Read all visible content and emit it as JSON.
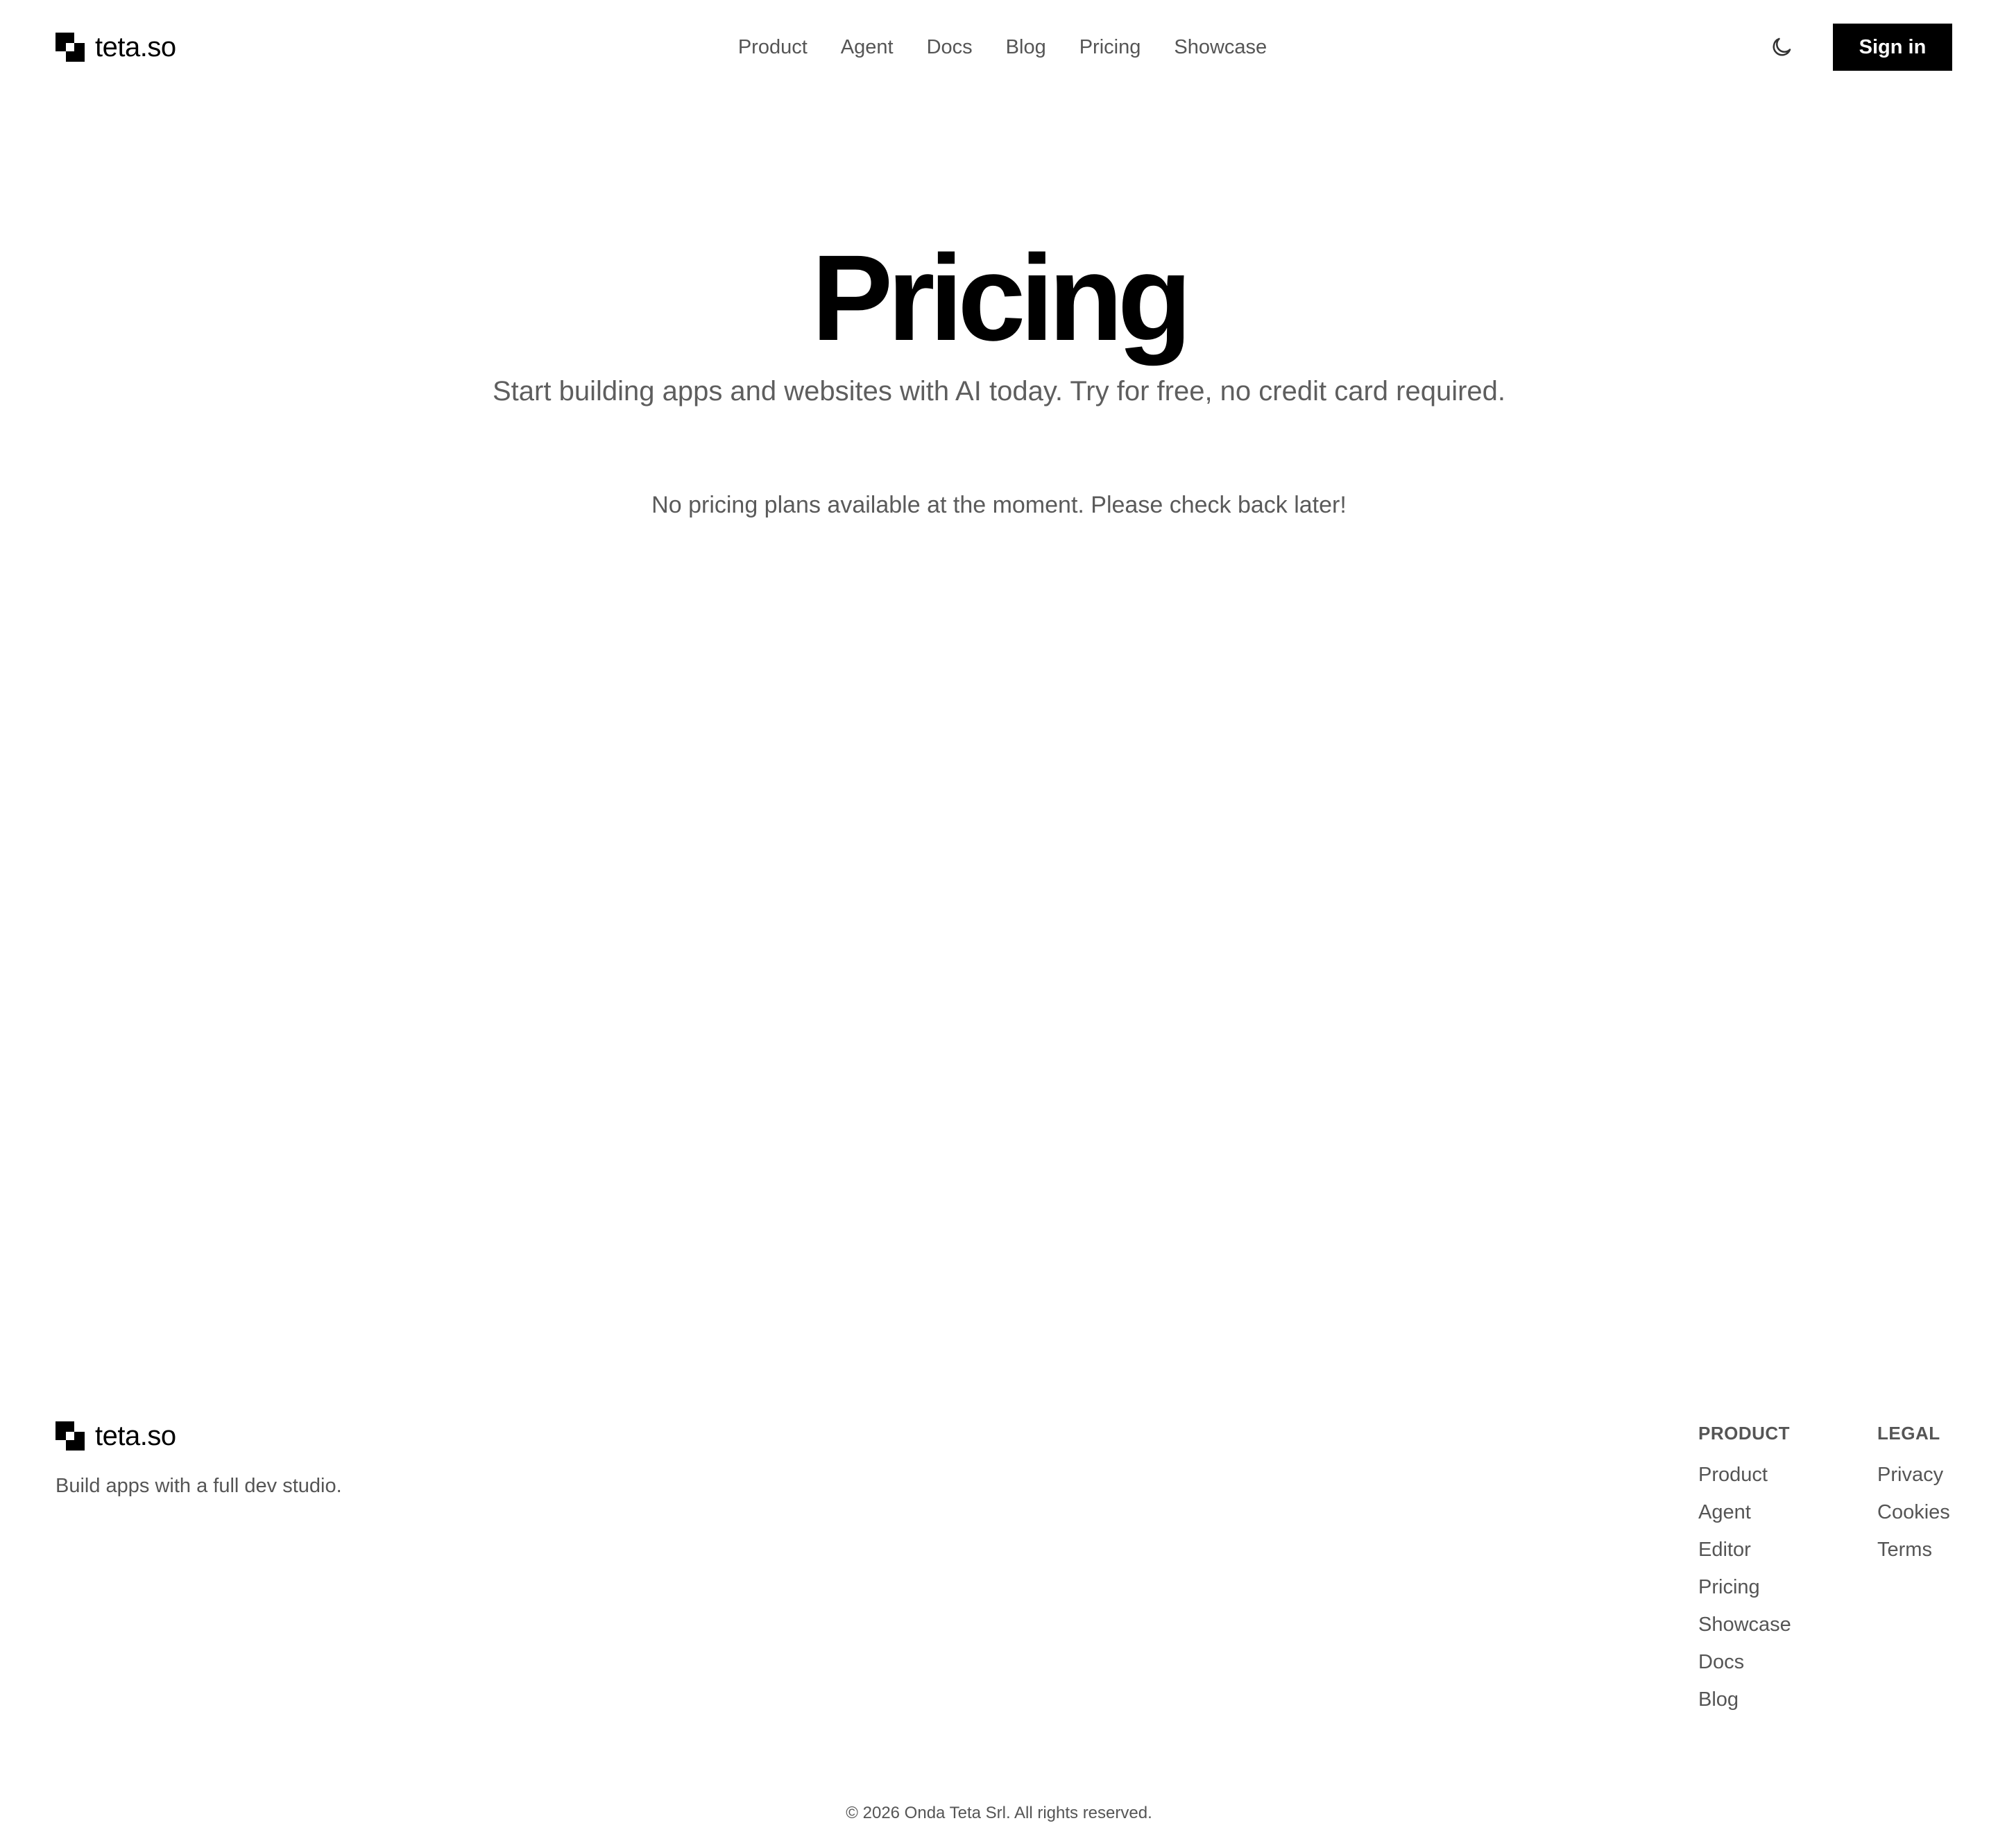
{
  "brand": {
    "name": "teta.so"
  },
  "nav": {
    "items": [
      {
        "label": "Product"
      },
      {
        "label": "Agent"
      },
      {
        "label": "Docs"
      },
      {
        "label": "Blog"
      },
      {
        "label": "Pricing"
      },
      {
        "label": "Showcase"
      }
    ],
    "theme_toggle_icon": "moon-icon",
    "signin_label": "Sign in"
  },
  "hero": {
    "title": "Pricing",
    "subtitle": "Start building apps and websites with AI today. Try for free, no credit card required.",
    "empty_message": "No pricing plans available at the moment. Please check back later!"
  },
  "footer": {
    "brand_name": "teta.so",
    "tagline": "Build apps with a full dev studio.",
    "product_heading": "PRODUCT",
    "product_links": [
      {
        "label": "Product"
      },
      {
        "label": "Agent"
      },
      {
        "label": "Editor"
      },
      {
        "label": "Pricing"
      },
      {
        "label": "Showcase"
      },
      {
        "label": "Docs"
      },
      {
        "label": "Blog"
      }
    ],
    "legal_heading": "LEGAL",
    "legal_links": [
      {
        "label": "Privacy"
      },
      {
        "label": "Cookies"
      },
      {
        "label": "Terms"
      }
    ],
    "copyright": "© 2026 Onda Teta Srl. All rights reserved."
  },
  "colors": {
    "primary": "#000000",
    "background": "#ffffff",
    "muted_text": "#555555"
  }
}
